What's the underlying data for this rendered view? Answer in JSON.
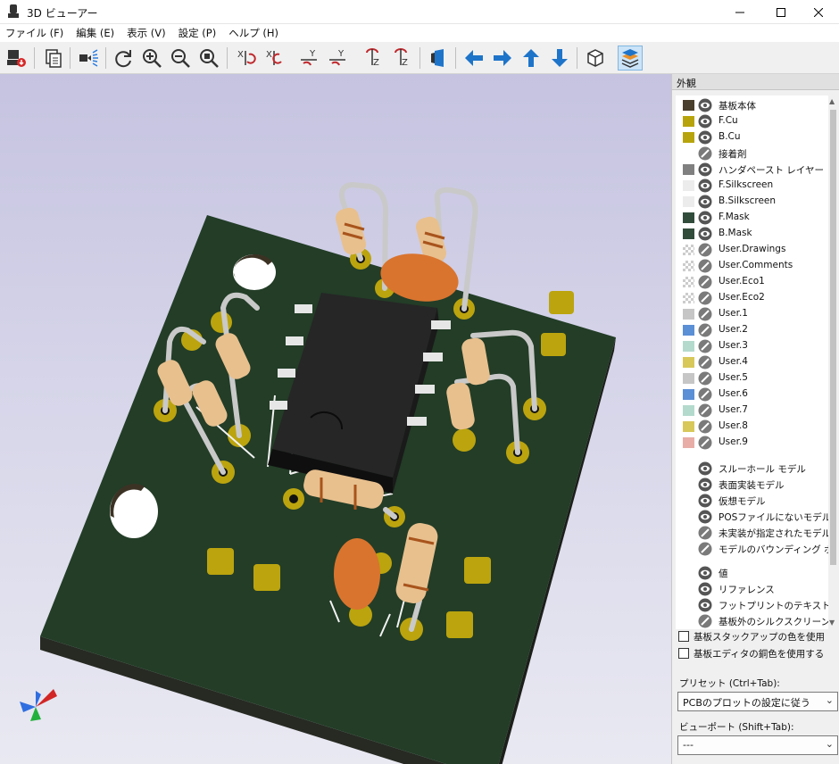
{
  "window": {
    "title": "3D ビューアー"
  },
  "menu": [
    "ファイル (F)",
    "編集 (E)",
    "表示 (V)",
    "設定 (P)",
    "ヘルプ (H)"
  ],
  "toolbar": {
    "icons": [
      "render-icon",
      "copy-icon",
      "raytrace-icon",
      "reload-icon",
      "zoom-in-icon",
      "zoom-out-icon",
      "zoom-fit-icon",
      "rotate-x-cw-icon",
      "rotate-x-ccw-icon",
      "rotate-y-cw-icon",
      "rotate-y-ccw-icon",
      "rotate-z-cw-icon",
      "rotate-z-ccw-icon",
      "flip-icon",
      "pan-left-icon",
      "pan-right-icon",
      "pan-up-icon",
      "pan-down-icon",
      "orthographic-icon",
      "toggle-panel-icon"
    ]
  },
  "panel": {
    "header": "外観",
    "layers": [
      {
        "name": "基板本体",
        "color": "#4a3f2c",
        "visible": true
      },
      {
        "name": "F.Cu",
        "color": "#b7a40c",
        "visible": true
      },
      {
        "name": "B.Cu",
        "color": "#b7a40c",
        "visible": true
      },
      {
        "name": "接着剤",
        "color": "",
        "visible": false
      },
      {
        "name": "ハンダペースト レイヤー",
        "color": "#808080",
        "visible": true
      },
      {
        "name": "F.Silkscreen",
        "color": "#ececec",
        "visible": true
      },
      {
        "name": "B.Silkscreen",
        "color": "#ececec",
        "visible": true
      },
      {
        "name": "F.Mask",
        "color": "#324c3c",
        "visible": true
      },
      {
        "name": "B.Mask",
        "color": "#324c3c",
        "visible": true
      },
      {
        "name": "User.Drawings",
        "color": "checker",
        "visible": false
      },
      {
        "name": "User.Comments",
        "color": "checker",
        "visible": false
      },
      {
        "name": "User.Eco1",
        "color": "checker",
        "visible": false
      },
      {
        "name": "User.Eco2",
        "color": "checker",
        "visible": false
      },
      {
        "name": "User.1",
        "color": "#c6c6c6",
        "visible": false
      },
      {
        "name": "User.2",
        "color": "#5b8fd6",
        "visible": false
      },
      {
        "name": "User.3",
        "color": "#b4dacd",
        "visible": false
      },
      {
        "name": "User.4",
        "color": "#d8c85a",
        "visible": false
      },
      {
        "name": "User.5",
        "color": "#c6c6c6",
        "visible": false
      },
      {
        "name": "User.6",
        "color": "#5b8fd6",
        "visible": false
      },
      {
        "name": "User.7",
        "color": "#b4dacd",
        "visible": false
      },
      {
        "name": "User.8",
        "color": "#d8c85a",
        "visible": false
      },
      {
        "name": "User.9",
        "color": "#e8ada6",
        "visible": false
      }
    ],
    "models": [
      {
        "name": "スルーホール モデル",
        "visible": true
      },
      {
        "name": "表面実装モデル",
        "visible": true
      },
      {
        "name": "仮想モデル",
        "visible": true
      },
      {
        "name": "POSファイルにないモデル",
        "visible": true
      },
      {
        "name": "未実装が指定されたモデル",
        "visible": false
      },
      {
        "name": "モデルのバウンディング ボックス",
        "visible": false
      }
    ],
    "extras": [
      {
        "name": "値",
        "visible": true
      },
      {
        "name": "リファレンス",
        "visible": true
      },
      {
        "name": "フットプリントのテキスト",
        "visible": true
      },
      {
        "name": "基板外のシルクスクリーン",
        "visible": false
      }
    ],
    "checkboxes": [
      "基板スタックアップの色を使用",
      "基板エディタの銅色を使用する"
    ],
    "preset_label": "プリセット (Ctrl+Tab):",
    "preset_value": "PCBのプロットの設定に従う",
    "viewport_label": "ビューポート (Shift+Tab):",
    "viewport_value": "---"
  }
}
